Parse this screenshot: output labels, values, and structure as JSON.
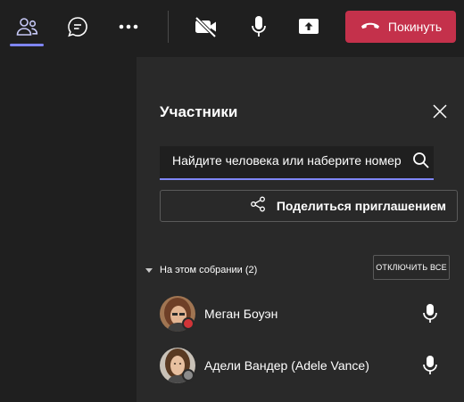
{
  "toolbar": {
    "leave_label": "Покинуть",
    "icons": [
      "people-icon",
      "chat-icon",
      "more-icon",
      "camera-off-icon",
      "microphone-icon",
      "share-tray-icon",
      "hang-up-icon"
    ],
    "leave_color": "#c4314b",
    "accent_color": "#7f85f5"
  },
  "panel": {
    "title": "Участники",
    "search": {
      "placeholder": "Найдите человека или наберите номер"
    },
    "invite_label": "Поделиться приглашением",
    "section": {
      "label": "На этом собрании (2)",
      "mute_all_label": "ОТКЛЮЧИТЬ ВСЕ"
    },
    "participants": [
      {
        "name": "Меган Боуэн",
        "status_color": "#d13438"
      },
      {
        "name": "Адели Вандер (Adele Vance)",
        "status_color": "#8a8a8a"
      }
    ]
  }
}
